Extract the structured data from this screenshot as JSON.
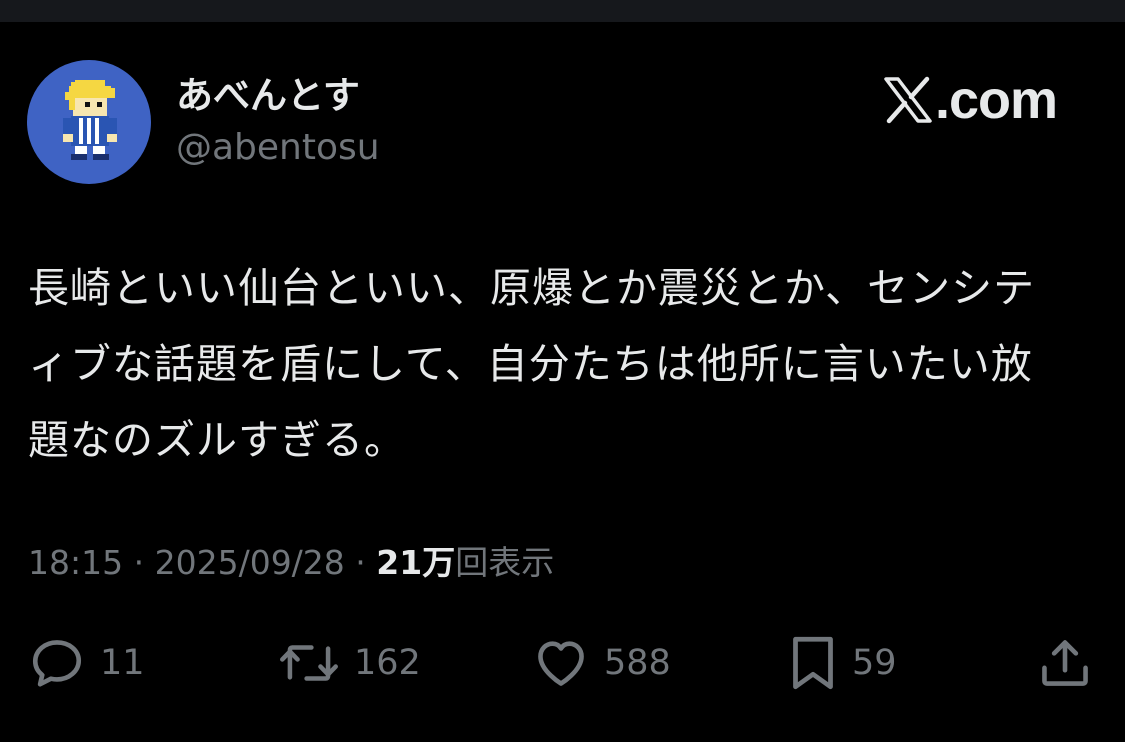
{
  "user": {
    "display_name": "あべんとす",
    "handle": "@abentosu"
  },
  "brand": {
    "label": ".com",
    "icon": "x-logo-icon"
  },
  "tweet": {
    "text": "長崎といい仙台といい、原爆とか震災とか、センシティブな話題を盾にして、自分たちは他所に言いたい放題なのズルすぎる。"
  },
  "meta": {
    "time": "18:15",
    "separator": " · ",
    "date": "2025/09/28",
    "views_count": "21万",
    "views_label": "回表示"
  },
  "actions": {
    "reply_count": "11",
    "retweet_count": "162",
    "like_count": "588",
    "bookmark_count": "59"
  },
  "colors": {
    "background": "#000000",
    "primary_text": "#e7e9ea",
    "secondary_text": "#71767b",
    "avatar_bg": "#3f63c4"
  }
}
